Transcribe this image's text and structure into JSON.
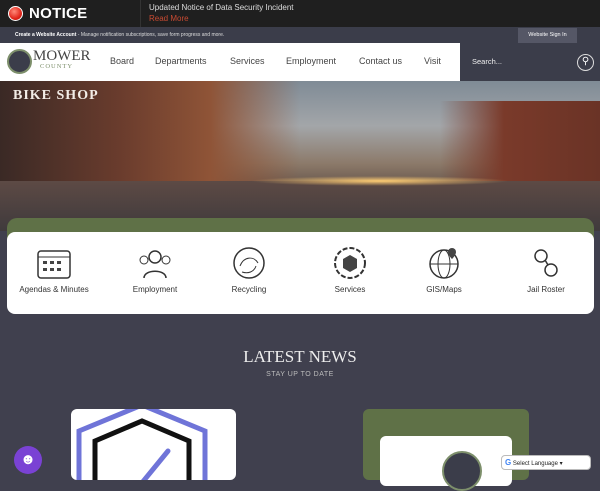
{
  "notice": {
    "label": "NOTICE",
    "message": "Updated Notice of Data Security Incident",
    "link": "Read More"
  },
  "account_bar": {
    "title": "Create a Website Account",
    "text": " - Manage notification subscriptions, save form progress and more.",
    "signin": "Website Sign In"
  },
  "brand": {
    "name": "MOWER",
    "sub": "COUNTY"
  },
  "nav": [
    "Board",
    "Departments",
    "Services",
    "Employment",
    "Contact us",
    "Visit"
  ],
  "search": {
    "placeholder": "Search..."
  },
  "hero": {
    "sign": "BIKE SHOP"
  },
  "quick_links": [
    "Agendas & Minutes",
    "Employment",
    "Recycling",
    "Services",
    "GIS/Maps",
    "Jail Roster"
  ],
  "news": {
    "title": "LATEST NEWS",
    "subtitle": "STAY UP TO DATE"
  },
  "language": {
    "label": "Select Language"
  }
}
